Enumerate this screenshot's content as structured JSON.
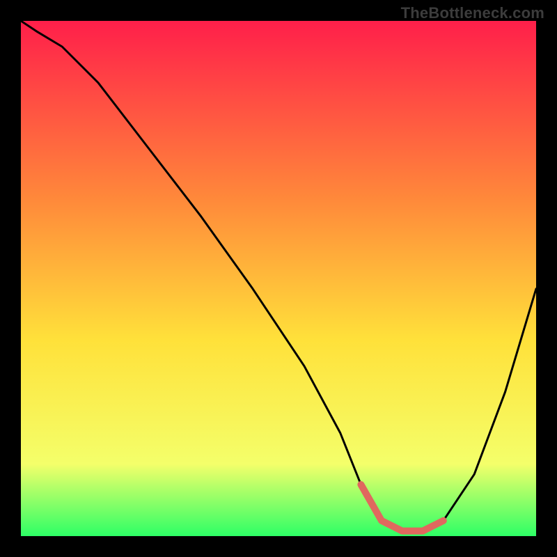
{
  "watermark": "TheBottleneck.com",
  "colors": {
    "frame": "#000000",
    "curve": "#000000",
    "accent": "#e0685e",
    "gradient_top": "#ff1f4a",
    "gradient_mid_upper": "#ff8a3a",
    "gradient_mid": "#ffe13a",
    "gradient_lower": "#f4ff6a",
    "gradient_bottom": "#2dff66",
    "watermark": "#3c3c3c"
  },
  "chart_data": {
    "type": "line",
    "title": "",
    "xlabel": "",
    "ylabel": "",
    "xlim": [
      0,
      100
    ],
    "ylim": [
      0,
      100
    ],
    "series": [
      {
        "name": "bottleneck-curve",
        "x": [
          0,
          3,
          8,
          15,
          25,
          35,
          45,
          55,
          62,
          66,
          70,
          74,
          78,
          82,
          88,
          94,
          100
        ],
        "values": [
          100,
          98,
          95,
          88,
          75,
          62,
          48,
          33,
          20,
          10,
          3,
          1,
          1,
          3,
          12,
          28,
          48
        ]
      }
    ],
    "annotations": [
      {
        "name": "accent-bottom-segment",
        "x_range": [
          66,
          82
        ],
        "values": [
          10,
          3,
          1,
          1,
          3
        ]
      }
    ]
  }
}
